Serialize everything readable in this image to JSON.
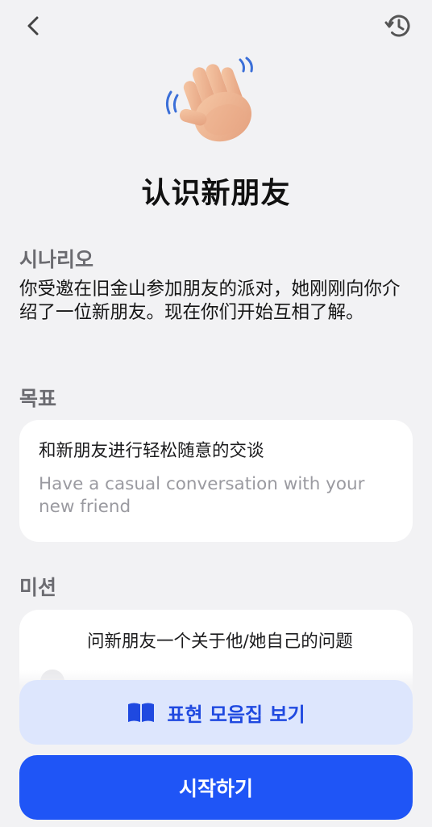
{
  "header": {
    "back_icon": "chevron-left-icon",
    "history_icon": "history-clock-icon"
  },
  "hero": {
    "icon": "waving-hand-emoji"
  },
  "title": "认识新朋友",
  "scenario": {
    "heading": "시나리오",
    "text": "你受邀在旧金山参加朋友的派对，她刚刚向你介绍了一位新朋友。现在你们开始互相了解。"
  },
  "goal": {
    "heading": "목표",
    "main": "和新朋友进行轻松随意的交谈",
    "translation": "Have a casual conversation with your new friend"
  },
  "mission": {
    "heading": "미션",
    "item": "问新朋友一个关于他/她自己的问题"
  },
  "buttons": {
    "expressions_label": "표현 모음집 보기",
    "expressions_icon": "open-book-icon",
    "start_label": "시작하기"
  },
  "colors": {
    "background": "#f2f2f4",
    "primary": "#1f55f6",
    "secondary_bg": "#dde6fd",
    "secondary_text": "#1f49e0"
  }
}
